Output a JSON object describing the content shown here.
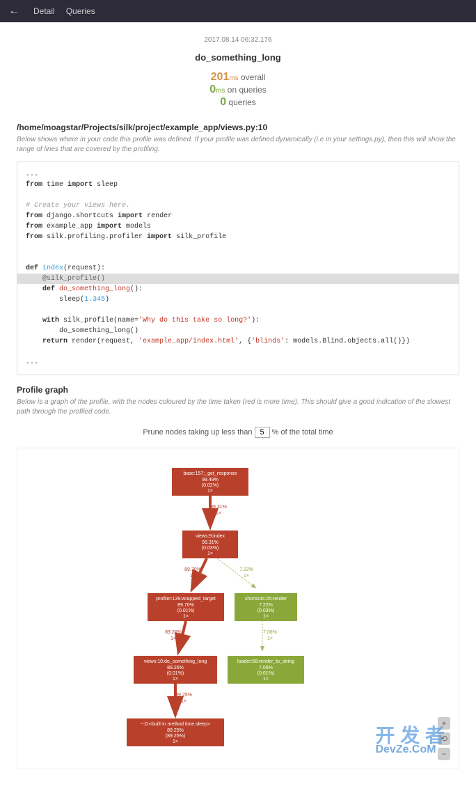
{
  "topbar": {
    "tabs": [
      "Detail",
      "Queries"
    ]
  },
  "timestamp": "2017.08.14 06:32.176",
  "page_title": "do_something_long",
  "stats": {
    "overall_num": "201",
    "overall_unit": "ms",
    "overall_label": " overall",
    "queries_time_num": "0",
    "queries_time_unit": "ms",
    "queries_time_label": " on queries",
    "queries_count_num": "0",
    "queries_count_label": " queries"
  },
  "file_path": "/home/moagstar/Projects/silk/project/example_app/views.py:10",
  "file_desc": "Below shows where in your code this profile was defined. If your profile was defined dynamically (i.e in your settings.py), then this will show the range of lines that are covered by the profiling.",
  "code": {
    "l1": "...",
    "l2a": "from",
    "l2b": " time ",
    "l2c": "import",
    "l2d": " sleep",
    "l3": "# Create your views here.",
    "l4a": "from",
    "l4b": " django.shortcuts ",
    "l4c": "import",
    "l4d": " render",
    "l5a": "from",
    "l5b": " example_app ",
    "l5c": "import",
    "l5d": " models",
    "l6a": "from",
    "l6b": " silk.profiling.profiler ",
    "l6c": "import",
    "l6d": " silk_profile",
    "l7a": "def ",
    "l7b": "index",
    "l7c": "(request):",
    "l8": "    @silk_profile()",
    "l9a": "    def ",
    "l9b": "do_something_long",
    "l9c": "():",
    "l10a": "        sleep(",
    "l10b": "1.345",
    "l10c": ")",
    "l11a": "    with",
    "l11b": " silk_profile(name=",
    "l11c": "'Why do this take so long?'",
    "l11d": "):",
    "l12": "        do_something_long()",
    "l13a": "    return",
    "l13b": " render(request, ",
    "l13c": "'example_app/index.html'",
    "l13d": ", {",
    "l13e": "'blinds'",
    "l13f": ": models.Blind.objects.all()})",
    "l14": "..."
  },
  "graph_section": {
    "title": "Profile graph",
    "desc": "Below is a graph of the profile, with the nodes coloured by the time taken (red is more time). This should give a good indication of the slowest path through the profiled code."
  },
  "prune": {
    "before": "Prune nodes taking up less than ",
    "value": "5",
    "after": " % of the total time"
  },
  "chart_data": {
    "type": "tree-graph",
    "nodes": [
      {
        "id": "n1",
        "label": "base:157:_get_response",
        "pct": "99.49%",
        "self": "(0.02%)",
        "calls": "1×",
        "color": "red"
      },
      {
        "id": "n2",
        "label": "views:9:index",
        "pct": "99.31%",
        "self": "(0.03%)",
        "calls": "1×",
        "color": "red"
      },
      {
        "id": "n3",
        "label": "profiler:139:wrapped_target",
        "pct": "89.70%",
        "self": "(0.01%)",
        "calls": "1×",
        "color": "red"
      },
      {
        "id": "n4",
        "label": "shortcuts:26:render",
        "pct": "7.22%",
        "self": "(0.03%)",
        "calls": "1×",
        "color": "green"
      },
      {
        "id": "n5",
        "label": "views:10:do_something_long",
        "pct": "89.26%",
        "self": "(0.01%)",
        "calls": "1×",
        "color": "red"
      },
      {
        "id": "n6",
        "label": "loader:58:render_to_string",
        "pct": "7.06%",
        "self": "(0.01%)",
        "calls": "1×",
        "color": "green"
      },
      {
        "id": "n7",
        "label": "~:0:<built-in method time.sleep>",
        "pct": "89.25%",
        "self": "(89.25%)",
        "calls": "1×",
        "color": "red"
      }
    ],
    "edges": [
      {
        "from": "n1",
        "to": "n2",
        "pct": "99.31%",
        "calls": "1×",
        "color": "red"
      },
      {
        "from": "n2",
        "to": "n3",
        "pct": "89.70%",
        "calls": "1×",
        "color": "red"
      },
      {
        "from": "n2",
        "to": "n4",
        "pct": "7.22%",
        "calls": "1×",
        "color": "green"
      },
      {
        "from": "n3",
        "to": "n5",
        "pct": "89.26%",
        "calls": "1×",
        "color": "red"
      },
      {
        "from": "n4",
        "to": "n6",
        "pct": "7.06%",
        "calls": "1×",
        "color": "green"
      },
      {
        "from": "n5",
        "to": "n7",
        "pct": "89.25%",
        "calls": "1×",
        "color": "red"
      }
    ]
  },
  "watermark": {
    "line1": "开 发 者",
    "line2": "DevZe.CoM"
  }
}
